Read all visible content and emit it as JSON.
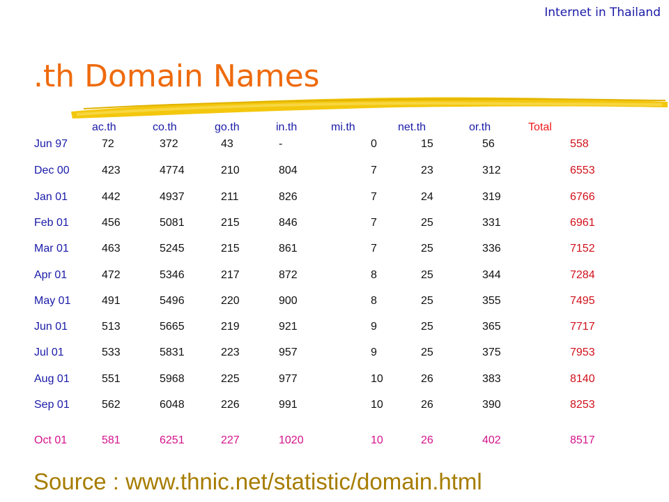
{
  "header_tag": "Internet in Thailand",
  "title": ".th Domain Names",
  "columns": [
    "ac.th",
    "co.th",
    "go.th",
    "in.th",
    "mi.th",
    "net.th",
    "or.th",
    "Total"
  ],
  "rows": [
    {
      "label": "Jun 97",
      "values": [
        "72",
        "372",
        "43",
        "-",
        "0",
        "15",
        "56",
        "558"
      ]
    },
    {
      "label": "Dec 00",
      "values": [
        "423",
        "4774",
        "210",
        "804",
        "7",
        "23",
        "312",
        "6553"
      ]
    },
    {
      "label": "Jan 01",
      "values": [
        "442",
        "4937",
        "211",
        "826",
        "7",
        "24",
        "319",
        "6766"
      ]
    },
    {
      "label": "Feb 01",
      "values": [
        "456",
        "5081",
        "215",
        "846",
        "7",
        "25",
        "331",
        "6961"
      ]
    },
    {
      "label": "Mar 01",
      "values": [
        "463",
        "5245",
        "215",
        "861",
        "7",
        "25",
        "336",
        "7152"
      ]
    },
    {
      "label": "Apr 01",
      "values": [
        "472",
        "5346",
        "217",
        "872",
        "8",
        "25",
        "344",
        "7284"
      ]
    },
    {
      "label": "May 01",
      "values": [
        "491",
        "5496",
        "220",
        "900",
        "8",
        "25",
        "355",
        "7495"
      ]
    },
    {
      "label": "Jun 01",
      "values": [
        "513",
        "5665",
        "219",
        "921",
        "9",
        "25",
        "365",
        "7717"
      ]
    },
    {
      "label": "Jul 01",
      "values": [
        "533",
        "5831",
        "223",
        "957",
        "9",
        "25",
        "375",
        "7953"
      ]
    },
    {
      "label": "Aug 01",
      "values": [
        "551",
        "5968",
        "225",
        "977",
        "10",
        "26",
        "383",
        "8140"
      ]
    },
    {
      "label": "Sep 01",
      "values": [
        "562",
        "6048",
        "226",
        "991",
        "10",
        "26",
        "390",
        "8253"
      ]
    },
    {
      "label": "Oct 01",
      "values": [
        "581",
        "6251",
        "227",
        "1020",
        "10",
        "26",
        "402",
        "8517"
      ],
      "highlight": true
    }
  ],
  "source": "Source : www.thnic.net/statistic/domain.html",
  "colors": {
    "title": "#ee6a0c",
    "header": "#1a1aa8",
    "total": "#d0101a",
    "highlight_row": "#d4128c",
    "source": "#a67c00",
    "brush": "#f2c400"
  }
}
